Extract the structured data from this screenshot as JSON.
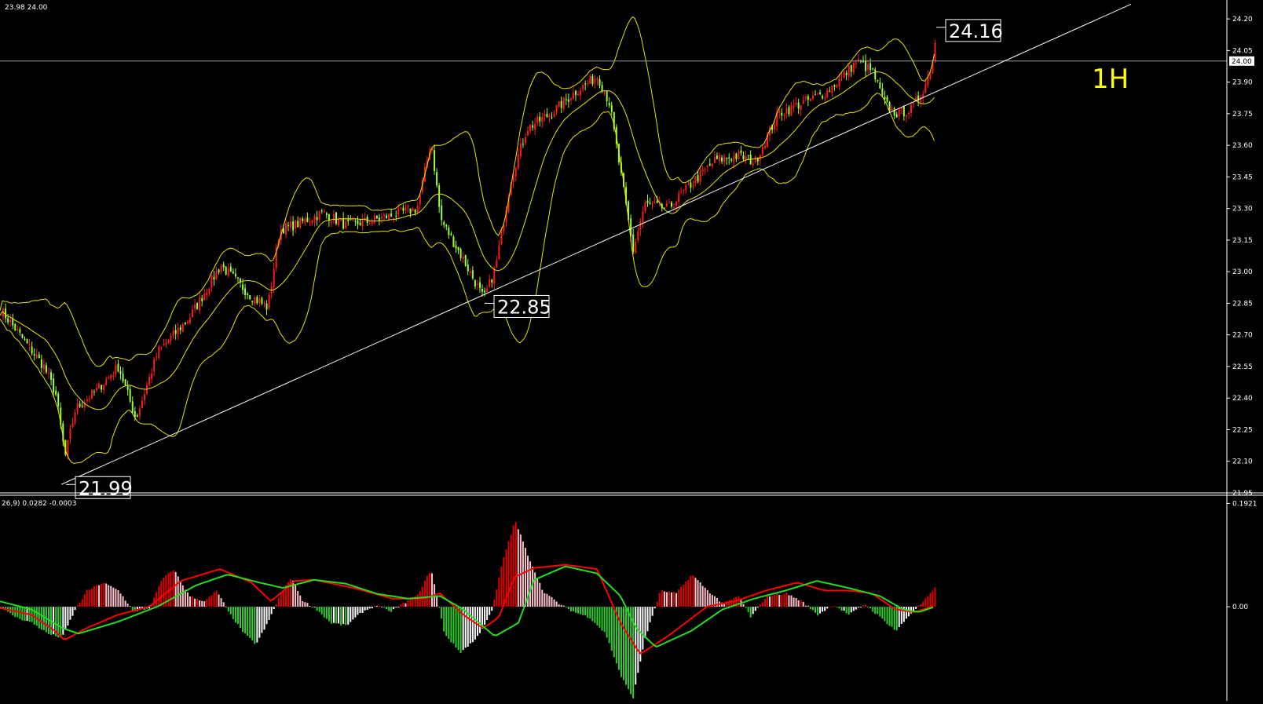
{
  "header": {
    "price_info": "23.98 24.00",
    "macd_info": "26,9) 0.0282 -0.0003"
  },
  "timeframe_label": "1H",
  "current_price_tag": "24.00",
  "price_annotations": [
    {
      "label": "21.99",
      "value": 21.99,
      "bar": 82
    },
    {
      "label": "22.85",
      "value": 22.85,
      "bar": 615
    },
    {
      "label": "24.16",
      "value": 24.16,
      "bar": 1190
    }
  ],
  "colors": {
    "background": "#000000",
    "bull_candle": "#ff1a1a",
    "bear_candle": "#9cff2e",
    "bollinger": "#e5e500",
    "trendline": "#ffffff",
    "macd_positive": "#e00000",
    "macd_positive_light": "#ffc0cb",
    "macd_negative": "#33cc33",
    "macd_negative_light": "#ffffff",
    "macd_line": "#ff0000",
    "signal_line": "#22dd22",
    "timeframe_label": "#ffff00"
  },
  "chart_data": [
    {
      "type": "candlestick",
      "title": "",
      "ylim": [
        21.95,
        24.26
      ],
      "yticks": [
        "24.20",
        "24.05",
        "23.90",
        "23.75",
        "23.60",
        "23.45",
        "23.30",
        "23.15",
        "23.00",
        "22.85",
        "22.70",
        "22.55",
        "22.40",
        "22.25",
        "22.10",
        "21.95"
      ],
      "horizontal_line": 24.0,
      "indicators": [
        "Bollinger Bands"
      ],
      "close_points": [
        {
          "x": 0,
          "y": 22.82
        },
        {
          "x": 30,
          "y": 22.67
        },
        {
          "x": 55,
          "y": 22.55
        },
        {
          "x": 70,
          "y": 22.42
        },
        {
          "x": 82,
          "y": 22.12
        },
        {
          "x": 95,
          "y": 22.35
        },
        {
          "x": 120,
          "y": 22.43
        },
        {
          "x": 150,
          "y": 22.55
        },
        {
          "x": 172,
          "y": 22.3
        },
        {
          "x": 200,
          "y": 22.62
        },
        {
          "x": 240,
          "y": 22.78
        },
        {
          "x": 280,
          "y": 23.03
        },
        {
          "x": 320,
          "y": 22.88
        },
        {
          "x": 340,
          "y": 22.83
        },
        {
          "x": 355,
          "y": 23.2
        },
        {
          "x": 380,
          "y": 23.23
        },
        {
          "x": 410,
          "y": 23.28
        },
        {
          "x": 440,
          "y": 23.22
        },
        {
          "x": 470,
          "y": 23.24
        },
        {
          "x": 500,
          "y": 23.27
        },
        {
          "x": 530,
          "y": 23.3
        },
        {
          "x": 548,
          "y": 23.62
        },
        {
          "x": 560,
          "y": 23.25
        },
        {
          "x": 590,
          "y": 23.05
        },
        {
          "x": 615,
          "y": 22.87
        },
        {
          "x": 630,
          "y": 23.02
        },
        {
          "x": 650,
          "y": 23.45
        },
        {
          "x": 670,
          "y": 23.68
        },
        {
          "x": 700,
          "y": 23.75
        },
        {
          "x": 730,
          "y": 23.85
        },
        {
          "x": 760,
          "y": 23.93
        },
        {
          "x": 775,
          "y": 23.8
        },
        {
          "x": 790,
          "y": 23.45
        },
        {
          "x": 805,
          "y": 23.1
        },
        {
          "x": 820,
          "y": 23.32
        },
        {
          "x": 850,
          "y": 23.3
        },
        {
          "x": 880,
          "y": 23.42
        },
        {
          "x": 910,
          "y": 23.53
        },
        {
          "x": 940,
          "y": 23.55
        },
        {
          "x": 960,
          "y": 23.52
        },
        {
          "x": 990,
          "y": 23.75
        },
        {
          "x": 1020,
          "y": 23.8
        },
        {
          "x": 1050,
          "y": 23.85
        },
        {
          "x": 1070,
          "y": 23.92
        },
        {
          "x": 1090,
          "y": 24.0
        },
        {
          "x": 1110,
          "y": 23.95
        },
        {
          "x": 1125,
          "y": 23.8
        },
        {
          "x": 1140,
          "y": 23.75
        },
        {
          "x": 1160,
          "y": 23.77
        },
        {
          "x": 1175,
          "y": 23.87
        },
        {
          "x": 1185,
          "y": 23.97
        },
        {
          "x": 1190,
          "y": 24.1
        }
      ],
      "trendline": {
        "from": {
          "x": 78,
          "y": 21.99
        },
        "to": {
          "x": 1440,
          "y": 24.27
        }
      }
    },
    {
      "type": "bar",
      "title": "MACD",
      "ylim": [
        -0.175,
        0.2
      ],
      "yticks": [
        "0.1921",
        "0.00"
      ],
      "histogram": [
        {
          "x": 0,
          "y": -0.002
        },
        {
          "x": 20,
          "y": -0.02
        },
        {
          "x": 40,
          "y": -0.03
        },
        {
          "x": 60,
          "y": -0.05
        },
        {
          "x": 78,
          "y": -0.058
        },
        {
          "x": 95,
          "y": -0.005
        },
        {
          "x": 110,
          "y": 0.03
        },
        {
          "x": 130,
          "y": 0.045
        },
        {
          "x": 150,
          "y": 0.03
        },
        {
          "x": 170,
          "y": -0.01
        },
        {
          "x": 190,
          "y": -0.002
        },
        {
          "x": 205,
          "y": 0.05
        },
        {
          "x": 220,
          "y": 0.07
        },
        {
          "x": 240,
          "y": 0.02
        },
        {
          "x": 260,
          "y": 0.01
        },
        {
          "x": 275,
          "y": 0.03
        },
        {
          "x": 290,
          "y": -0.01
        },
        {
          "x": 310,
          "y": -0.05
        },
        {
          "x": 325,
          "y": -0.07
        },
        {
          "x": 340,
          "y": -0.03
        },
        {
          "x": 355,
          "y": 0.02
        },
        {
          "x": 370,
          "y": 0.055
        },
        {
          "x": 385,
          "y": 0.01
        },
        {
          "x": 400,
          "y": -0.002
        },
        {
          "x": 420,
          "y": -0.03
        },
        {
          "x": 440,
          "y": -0.035
        },
        {
          "x": 460,
          "y": -0.01
        },
        {
          "x": 480,
          "y": 0.004
        },
        {
          "x": 495,
          "y": -0.01
        },
        {
          "x": 510,
          "y": 0.004
        },
        {
          "x": 530,
          "y": 0.02
        },
        {
          "x": 548,
          "y": 0.07
        },
        {
          "x": 565,
          "y": -0.05
        },
        {
          "x": 585,
          "y": -0.085
        },
        {
          "x": 605,
          "y": -0.06
        },
        {
          "x": 625,
          "y": -0.01
        },
        {
          "x": 640,
          "y": 0.09
        },
        {
          "x": 655,
          "y": 0.16
        },
        {
          "x": 670,
          "y": 0.1
        },
        {
          "x": 690,
          "y": 0.03
        },
        {
          "x": 710,
          "y": 0.006
        },
        {
          "x": 730,
          "y": -0.01
        },
        {
          "x": 750,
          "y": -0.02
        },
        {
          "x": 770,
          "y": -0.05
        },
        {
          "x": 790,
          "y": -0.13
        },
        {
          "x": 805,
          "y": -0.17
        },
        {
          "x": 820,
          "y": -0.06
        },
        {
          "x": 840,
          "y": 0.03
        },
        {
          "x": 860,
          "y": 0.025
        },
        {
          "x": 880,
          "y": 0.06
        },
        {
          "x": 900,
          "y": 0.03
        },
        {
          "x": 920,
          "y": 0.005
        },
        {
          "x": 940,
          "y": 0.02
        },
        {
          "x": 955,
          "y": -0.02
        },
        {
          "x": 975,
          "y": 0.02
        },
        {
          "x": 1000,
          "y": 0.025
        },
        {
          "x": 1020,
          "y": 0.01
        },
        {
          "x": 1040,
          "y": -0.015
        },
        {
          "x": 1060,
          "y": 0.004
        },
        {
          "x": 1080,
          "y": -0.015
        },
        {
          "x": 1100,
          "y": 0.005
        },
        {
          "x": 1120,
          "y": -0.02
        },
        {
          "x": 1140,
          "y": -0.045
        },
        {
          "x": 1160,
          "y": -0.01
        },
        {
          "x": 1175,
          "y": 0.01
        },
        {
          "x": 1190,
          "y": 0.035
        }
      ],
      "macd_line": [
        {
          "x": 0,
          "y": -0.002
        },
        {
          "x": 40,
          "y": -0.015
        },
        {
          "x": 70,
          "y": -0.045
        },
        {
          "x": 82,
          "y": -0.062
        },
        {
          "x": 110,
          "y": -0.04
        },
        {
          "x": 150,
          "y": -0.015
        },
        {
          "x": 190,
          "y": 0.0
        },
        {
          "x": 230,
          "y": 0.048
        },
        {
          "x": 280,
          "y": 0.07
        },
        {
          "x": 320,
          "y": 0.045
        },
        {
          "x": 345,
          "y": 0.01
        },
        {
          "x": 375,
          "y": 0.048
        },
        {
          "x": 400,
          "y": 0.05
        },
        {
          "x": 450,
          "y": 0.035
        },
        {
          "x": 500,
          "y": 0.015
        },
        {
          "x": 540,
          "y": 0.015
        },
        {
          "x": 560,
          "y": 0.025
        },
        {
          "x": 590,
          "y": -0.015
        },
        {
          "x": 615,
          "y": -0.04
        },
        {
          "x": 635,
          "y": -0.02
        },
        {
          "x": 655,
          "y": 0.055
        },
        {
          "x": 680,
          "y": 0.072
        },
        {
          "x": 720,
          "y": 0.078
        },
        {
          "x": 760,
          "y": 0.07
        },
        {
          "x": 790,
          "y": -0.03
        },
        {
          "x": 815,
          "y": -0.088
        },
        {
          "x": 850,
          "y": -0.055
        },
        {
          "x": 900,
          "y": 0.0
        },
        {
          "x": 940,
          "y": 0.012
        },
        {
          "x": 975,
          "y": 0.03
        },
        {
          "x": 1015,
          "y": 0.045
        },
        {
          "x": 1050,
          "y": 0.03
        },
        {
          "x": 1080,
          "y": 0.03
        },
        {
          "x": 1110,
          "y": 0.025
        },
        {
          "x": 1140,
          "y": -0.005
        },
        {
          "x": 1165,
          "y": -0.01
        },
        {
          "x": 1190,
          "y": 0.002
        }
      ],
      "signal_line": [
        {
          "x": 0,
          "y": 0.01
        },
        {
          "x": 40,
          "y": -0.005
        },
        {
          "x": 80,
          "y": -0.04
        },
        {
          "x": 100,
          "y": -0.05
        },
        {
          "x": 150,
          "y": -0.028
        },
        {
          "x": 200,
          "y": 0.0
        },
        {
          "x": 250,
          "y": 0.04
        },
        {
          "x": 290,
          "y": 0.06
        },
        {
          "x": 330,
          "y": 0.045
        },
        {
          "x": 360,
          "y": 0.035
        },
        {
          "x": 400,
          "y": 0.05
        },
        {
          "x": 440,
          "y": 0.043
        },
        {
          "x": 480,
          "y": 0.024
        },
        {
          "x": 520,
          "y": 0.015
        },
        {
          "x": 560,
          "y": 0.02
        },
        {
          "x": 590,
          "y": -0.005
        },
        {
          "x": 630,
          "y": -0.055
        },
        {
          "x": 660,
          "y": -0.03
        },
        {
          "x": 680,
          "y": 0.05
        },
        {
          "x": 720,
          "y": 0.075
        },
        {
          "x": 760,
          "y": 0.062
        },
        {
          "x": 790,
          "y": 0.02
        },
        {
          "x": 810,
          "y": -0.04
        },
        {
          "x": 835,
          "y": -0.075
        },
        {
          "x": 880,
          "y": -0.045
        },
        {
          "x": 920,
          "y": -0.005
        },
        {
          "x": 960,
          "y": 0.015
        },
        {
          "x": 1000,
          "y": 0.03
        },
        {
          "x": 1040,
          "y": 0.048
        },
        {
          "x": 1080,
          "y": 0.035
        },
        {
          "x": 1120,
          "y": 0.02
        },
        {
          "x": 1150,
          "y": -0.005
        },
        {
          "x": 1170,
          "y": -0.01
        },
        {
          "x": 1190,
          "y": 0.0
        }
      ]
    }
  ]
}
